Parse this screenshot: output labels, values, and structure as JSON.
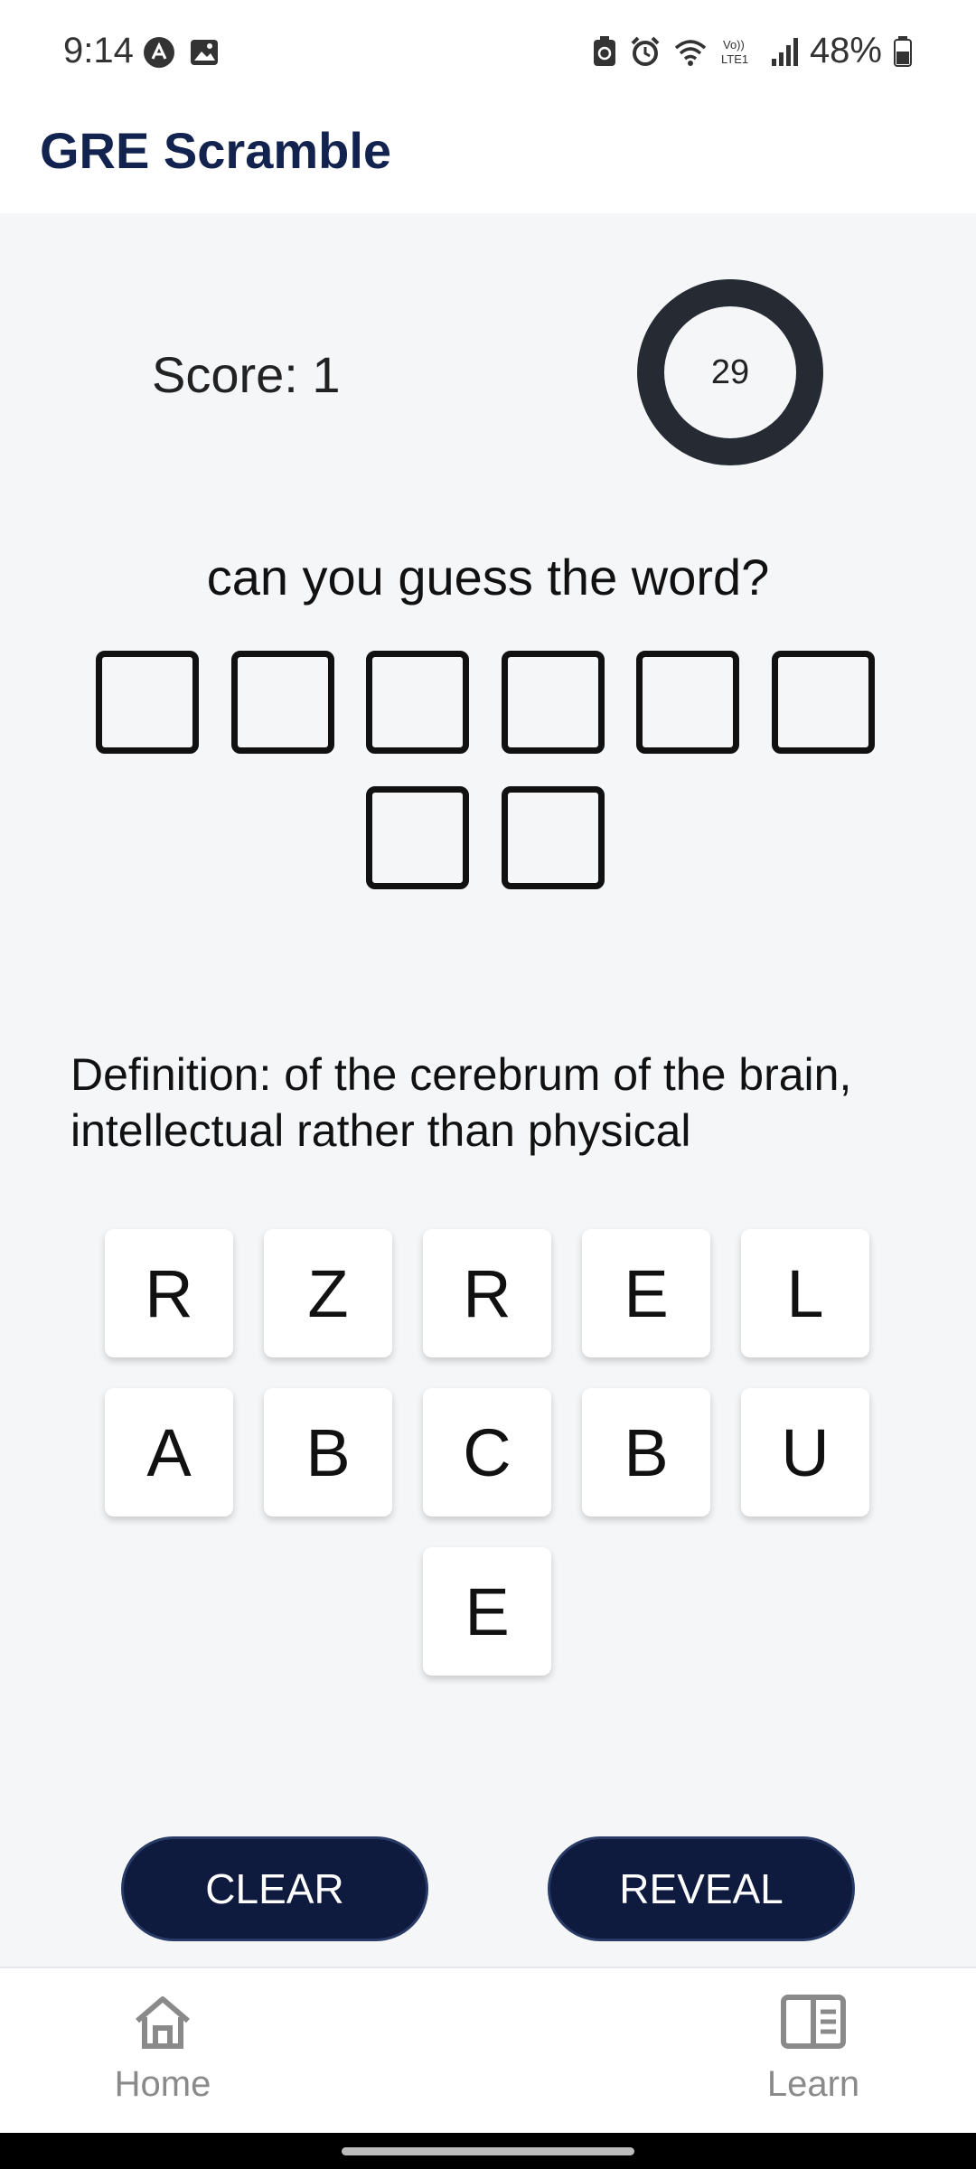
{
  "status_bar": {
    "time": "9:14",
    "battery": "48%",
    "left_icons": [
      "app-notification-icon",
      "image-icon"
    ],
    "right_icons": [
      "battery-saver-icon",
      "alarm-icon",
      "wifi-icon",
      "volte-icon",
      "signal-icon",
      "battery-icon"
    ]
  },
  "app_bar": {
    "title": "GRE Scramble"
  },
  "game": {
    "score_label": "Score: 1",
    "timer_value": "29",
    "prompt": "can you guess the word?",
    "answer_slot_count": 8,
    "definition": "Definition: of the cerebrum of the brain, intellectual rather than physical",
    "letters": [
      "R",
      "Z",
      "R",
      "E",
      "L",
      "A",
      "B",
      "C",
      "B",
      "U",
      "E"
    ]
  },
  "actions": {
    "clear_label": "CLEAR",
    "reveal_label": "REVEAL"
  },
  "bottom_nav": {
    "home_label": "Home",
    "learn_label": "Learn"
  },
  "colors": {
    "brand_navy": "#13234f",
    "button_navy": "#0e1b3f",
    "background": "#f5f6f8",
    "timer_ring": "#262b33"
  }
}
